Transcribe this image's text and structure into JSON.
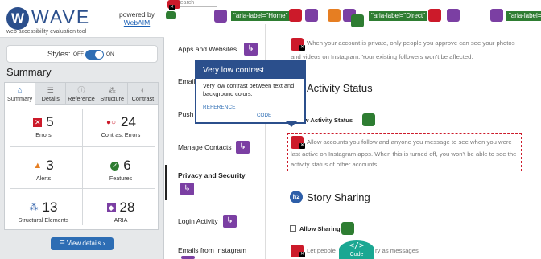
{
  "wave": {
    "logo_letter": "W",
    "logo_word": "WAVE",
    "tagline": "web accessibility evaluation tool",
    "powered_by": "powered by",
    "webaim": "WebAIM",
    "styles_label": "Styles:",
    "toggle_off": "OFF",
    "toggle_on": "ON",
    "summary_title": "Summary",
    "tabs": [
      {
        "label": "Summary",
        "icon": "home-icon"
      },
      {
        "label": "Details",
        "icon": "list-icon"
      },
      {
        "label": "Reference",
        "icon": "info-icon"
      },
      {
        "label": "Structure",
        "icon": "structure-icon"
      },
      {
        "label": "Contrast",
        "icon": "contrast-icon"
      }
    ],
    "stats": [
      {
        "value": "5",
        "label": "Errors",
        "color": "#cc1a2a"
      },
      {
        "value": "24",
        "label": "Contrast Errors",
        "color": "#cc1a2a"
      },
      {
        "value": "3",
        "label": "Alerts",
        "color": "#e67e22"
      },
      {
        "value": "6",
        "label": "Features",
        "color": "#2e7d32"
      },
      {
        "value": "13",
        "label": "Structural Elements",
        "color": "#2d5ea8"
      },
      {
        "value": "28",
        "label": "ARIA",
        "color": "#7b3fa3"
      }
    ],
    "view_details": "☰ View details ›"
  },
  "page": {
    "search_placeholder": "Search",
    "aria_labels": [
      "\"aria-label=\"Home\"",
      "\"aria-label=\"Direct\"",
      "\"aria-label=\"Find F"
    ],
    "nav": [
      {
        "label": "Apps and Websites"
      },
      {
        "label": "Email"
      },
      {
        "label": "Push"
      },
      {
        "label": "Manage Contacts"
      },
      {
        "label": "Privacy and Security"
      },
      {
        "label": "Login Activity"
      },
      {
        "label": "Emails from Instagram"
      }
    ],
    "private_text_1": "When your account is private, only people you approve can see your photos",
    "private_text_2": "and videos on Instagram. Your existing followers won't be affected.",
    "activity_heading": "Activity Status",
    "show_activity": "ow Activity Status",
    "activity_text_1": "Allow accounts you follow and anyone you message to see when you were",
    "activity_text_2": "last active on Instagram apps. When this is turned off, you won't be able to see the",
    "activity_text_3": "activity status of other accounts.",
    "story_heading": "Story Sharing",
    "h2_badge": "h2",
    "allow_sharing": "Allow Sharing",
    "let_people_1": "Let people",
    "let_people_2": "ry as messages"
  },
  "tooltip": {
    "title": "Very low contrast",
    "body": "Very low contrast between text and background colors.",
    "reference": "REFERENCE",
    "code": "CODE"
  },
  "code_button": {
    "glyph": "</>",
    "label": "Code"
  }
}
